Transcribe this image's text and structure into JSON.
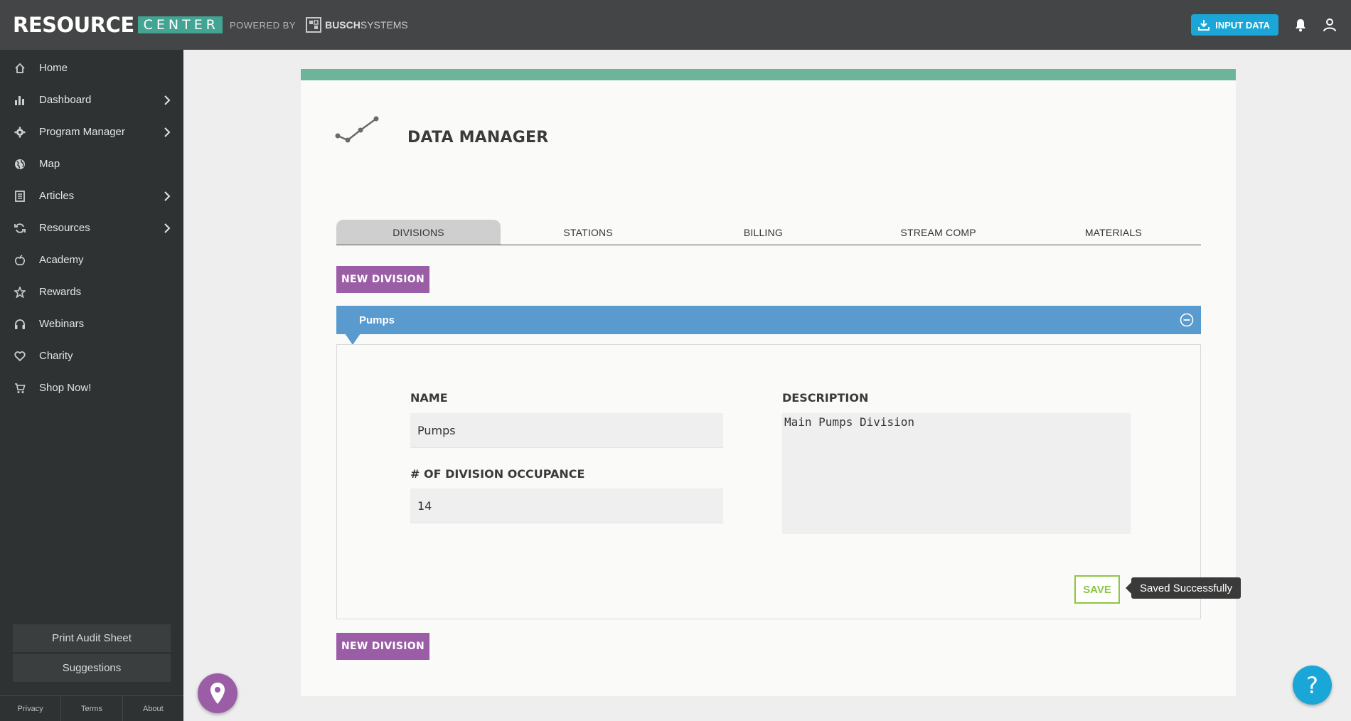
{
  "brand": {
    "resource": "RESOURCE",
    "center": "CENTER",
    "powered_by": "POWERED BY",
    "busch_bold": "BUSCH",
    "busch_rest": "SYSTEMS"
  },
  "header": {
    "input_data_label": "INPUT DATA",
    "accent_color": "#1aa7d8"
  },
  "sidebar": {
    "items": [
      {
        "label": "Home",
        "icon": "home-icon",
        "has_submenu": false
      },
      {
        "label": "Dashboard",
        "icon": "bar-chart-icon",
        "has_submenu": true
      },
      {
        "label": "Program Manager",
        "icon": "gear-icon",
        "has_submenu": true
      },
      {
        "label": "Map",
        "icon": "globe-icon",
        "has_submenu": false
      },
      {
        "label": "Articles",
        "icon": "document-icon",
        "has_submenu": true
      },
      {
        "label": "Resources",
        "icon": "refresh-icon",
        "has_submenu": true
      },
      {
        "label": "Academy",
        "icon": "apple-icon",
        "has_submenu": false
      },
      {
        "label": "Rewards",
        "icon": "star-icon",
        "has_submenu": false
      },
      {
        "label": "Webinars",
        "icon": "headphones-icon",
        "has_submenu": false
      },
      {
        "label": "Charity",
        "icon": "heart-icon",
        "has_submenu": false
      },
      {
        "label": "Shop Now!",
        "icon": "cart-icon",
        "has_submenu": false
      }
    ],
    "print_audit_sheet": "Print Audit Sheet",
    "suggestions": "Suggestions",
    "footer": {
      "privacy": "Privacy",
      "terms": "Terms",
      "about": "About"
    }
  },
  "main": {
    "title": "DATA MANAGER",
    "tabs": [
      {
        "label": "DIVISIONS",
        "active": true
      },
      {
        "label": "STATIONS",
        "active": false
      },
      {
        "label": "BILLING",
        "active": false
      },
      {
        "label": "STREAM COMP",
        "active": false
      },
      {
        "label": "MATERIALS",
        "active": false
      }
    ],
    "new_division_label": "NEW DIVISION",
    "division": {
      "header": "Pumps",
      "name_label": "NAME",
      "name_value": "Pumps",
      "occupance_label": "# OF DIVISION OCCUPANCE",
      "occupance_value": "14",
      "description_label": "DESCRIPTION",
      "description_value": "Main Pumps Division",
      "save_label": "SAVE",
      "tooltip": "Saved Successfully"
    }
  },
  "help": {
    "label": "?"
  },
  "colors": {
    "topbar": "#444546",
    "sidebar": "#2f3233",
    "accent_green": "#6cb59b",
    "purple": "#9b5ea6",
    "blue_header": "#5a9bcf",
    "save_green": "#8dc63f"
  }
}
